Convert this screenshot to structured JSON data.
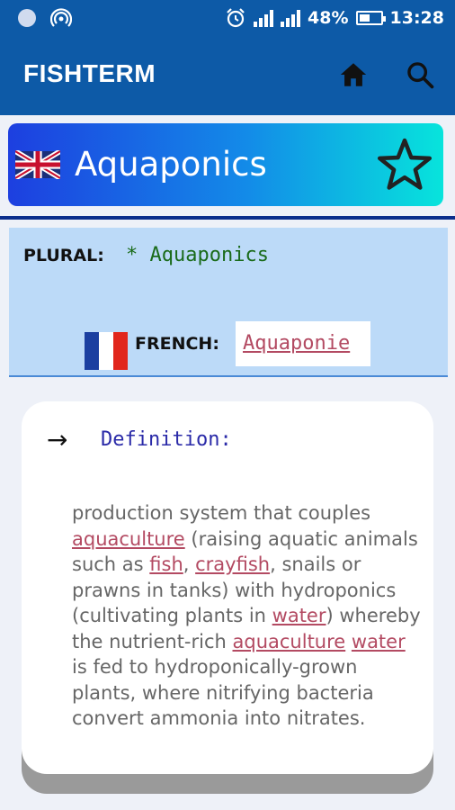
{
  "status_bar": {
    "battery": "48%",
    "battery_level": 0.48,
    "time": "13:28",
    "icons": [
      "circle-notification-icon",
      "hotspot-icon",
      "alarm-icon",
      "signal-icon",
      "signal-h-icon",
      "battery-icon"
    ]
  },
  "app_bar": {
    "title": "FISHTERM",
    "icons": [
      "home-icon",
      "search-icon"
    ]
  },
  "term": {
    "word": "Aquaponics",
    "language_flag": "uk-flag-icon",
    "favorite_icon": "star-outline-icon"
  },
  "info": {
    "plural_label": "PLURAL:",
    "plural_value": "* Aquaponics",
    "french_label": "FRENCH:",
    "french_value": "Aquaponie"
  },
  "definition": {
    "arrow": "→",
    "label": "Definition:",
    "seg1": "production system that couples ",
    "link1": "aquaculture",
    "seg2": " (raising aquatic animals such as ",
    "link2": "fish",
    "seg3": ", ",
    "link3": "crayfish",
    "seg4": ", snails or prawns in tanks) with hydroponics (cultivating plants in ",
    "link4": "water",
    "seg5": ") whereby the nutrient-rich ",
    "link5": "aquaculture",
    "seg6": " ",
    "link6": "water",
    "seg7": " is fed to hydroponically-grown plants, where nitrifying bacteria convert ammonia into nitrates."
  },
  "colors": {
    "app_bar": "#0d5aa7",
    "banner_start": "#1d3fe0",
    "banner_end": "#07e4dc",
    "info_panel": "#bcdaf8",
    "link": "#b34a62",
    "plural_value": "#1a6b1a",
    "definition_label": "#2a2aa8"
  }
}
